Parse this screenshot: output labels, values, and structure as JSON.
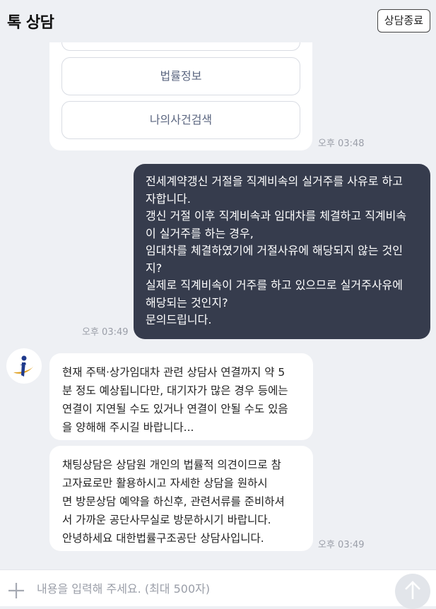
{
  "header": {
    "title": "톡 상담",
    "end_button": "상담종료"
  },
  "menu": {
    "buttons": [
      "법률정보",
      "나의사건검색"
    ],
    "time": "오후 03:48"
  },
  "user_message": {
    "lines": [
      "전세계약갱신 거절을 직계비속의 실거주를 사유로 하고",
      "자합니다.",
      "갱신 거절 이후 직계비속과 임대차를 체결하고 직계비속",
      "이 실거주를 하는 경우,",
      "임대차를 체결하였기에 거절사유에 해당되지 않는 것인",
      "지?",
      "실제로 직계비속이 거주를 하고 있으므로 실거주사유에",
      "해당되는 것인지?",
      "문의드립니다."
    ],
    "time": "오후 03:49"
  },
  "bot_messages": [
    {
      "lines": [
        "현재 주택·상가임대차 관련 상담사 연결까지 약 5",
        "분 정도 예상됩니다만, 대기자가 많은 경우 등에는",
        "연결이 지연될 수도 있거나 연결이 안될 수도 있음",
        "을 양해해 주시길 바랍니다..."
      ]
    },
    {
      "lines": [
        "채팅상담은 상담원 개인의 법률적 의견이므로 참",
        "고자료로만 활용하시고 자세한 상담을 원하시",
        "면 방문상담 예약을 하신후, 관련서류를 준비하셔",
        "서 가까운 공단사무실로 방문하시기 바랍니다.",
        "안녕하세요 대한법률구조공단 상담사입니다."
      ]
    }
  ],
  "bot_time": "오후 03:49",
  "input": {
    "placeholder": "내용을 입력해 주세요. (최대 500자)",
    "value": ""
  },
  "icons": {
    "attach": "plus-icon",
    "send": "arrow-up-icon",
    "avatar": "agency-logo-icon"
  },
  "colors": {
    "background": "#eef0f4",
    "user_bubble": "#363c4d",
    "logo_blue": "#1f3a8c",
    "logo_gold": "#e0a020"
  }
}
